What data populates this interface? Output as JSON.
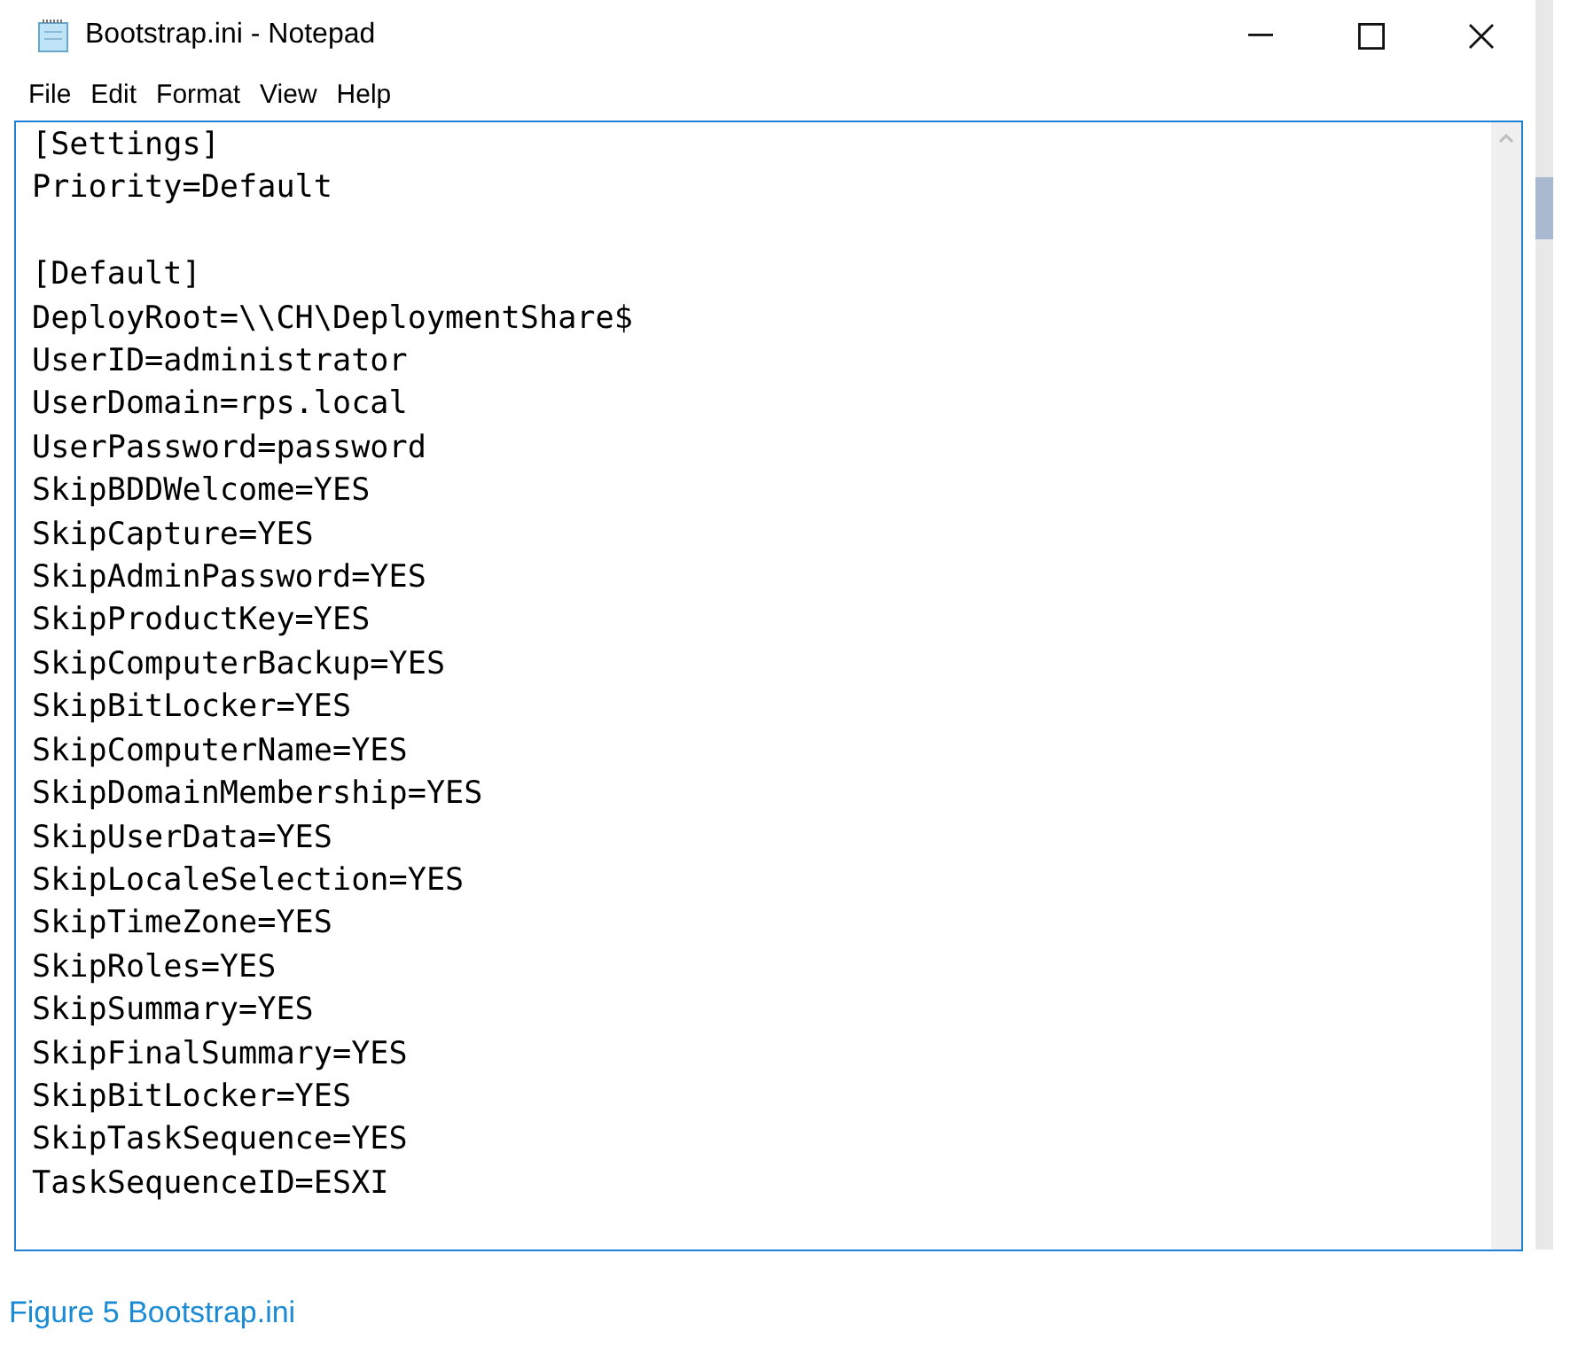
{
  "window": {
    "title": "Bootstrap.ini - Notepad"
  },
  "menu": [
    "File",
    "Edit",
    "Format",
    "View",
    "Help"
  ],
  "editor": {
    "text": "[Settings]\nPriority=Default\n\n[Default]\nDeployRoot=\\\\CH\\DeploymentShare$\nUserID=administrator\nUserDomain=rps.local\nUserPassword=password\nSkipBDDWelcome=YES\nSkipCapture=YES\nSkipAdminPassword=YES\nSkipProductKey=YES\nSkipComputerBackup=YES\nSkipBitLocker=YES\nSkipComputerName=YES\nSkipDomainMembership=YES\nSkipUserData=YES\nSkipLocaleSelection=YES\nSkipTimeZone=YES\nSkipRoles=YES\nSkipSummary=YES\nSkipFinalSummary=YES\nSkipBitLocker=YES\nSkipTaskSequence=YES\nTaskSequenceID=ESXI"
  },
  "caption": "Figure 5 Bootstrap.ini"
}
